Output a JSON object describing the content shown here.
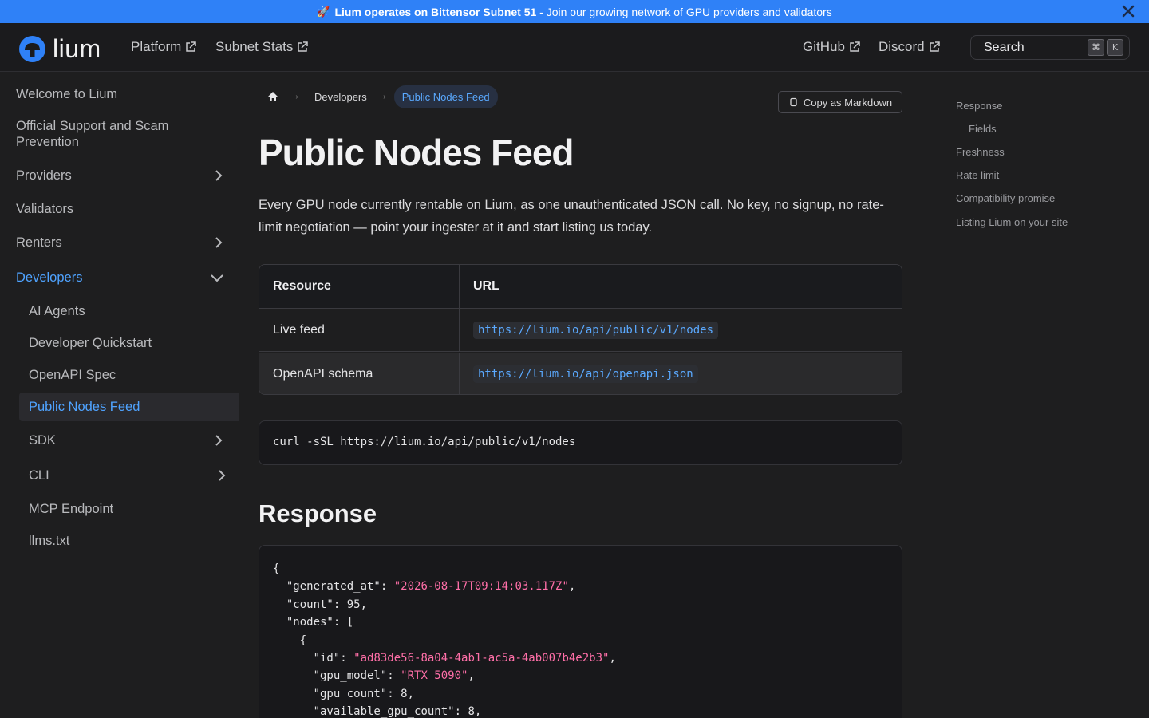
{
  "announcement": {
    "bold": "Lium operates on Bittensor Subnet 51",
    "text": " - Join our growing network of GPU providers and validators"
  },
  "navbar": {
    "logo_text": "lium",
    "links": [
      "Platform",
      "Subnet Stats",
      "GitHub",
      "Discord"
    ],
    "search_placeholder": "Search",
    "shortcut": [
      "⌘",
      "K"
    ]
  },
  "sidebar": {
    "items": [
      "Welcome to Lium",
      "Official Support and Scam Prevention",
      "Providers",
      "Validators",
      "Renters",
      "Developers",
      "AI Agents",
      "Developer Quickstart",
      "OpenAPI Spec",
      "Public Nodes Feed",
      "SDK",
      "CLI",
      "MCP Endpoint",
      "llms.txt"
    ]
  },
  "breadcrumb": {
    "items": [
      "Developers",
      "Public Nodes Feed"
    ]
  },
  "actions": {
    "copy_markdown": "Copy as Markdown"
  },
  "page": {
    "title": "Public Nodes Feed",
    "intro": "Every GPU node currently rentable on Lium, as one unauthenticated JSON call. No key, no signup, no rate-limit negotiation — point your ingester at it and start listing us today."
  },
  "table": {
    "headers": [
      "Resource",
      "URL"
    ],
    "rows": [
      [
        "Live feed",
        "https://lium.io/api/public/v1/nodes"
      ],
      [
        "OpenAPI schema",
        "https://lium.io/api/openapi.json"
      ]
    ]
  },
  "curl_command": "curl -sSL https://lium.io/api/public/v1/nodes",
  "response": {
    "heading": "Response",
    "json": {
      "generated_at_key": "\"generated_at\"",
      "generated_at_val": "\"2026-08-17T09:14:03.117Z\"",
      "count_key": "\"count\"",
      "count_val": "95",
      "nodes_key": "\"nodes\"",
      "id_key": "\"id\"",
      "id_val": "\"ad83de56-8a04-4ab1-ac5a-4ab007b4e2b3\"",
      "gpu_model_key": "\"gpu_model\"",
      "gpu_model_val": "\"RTX 5090\"",
      "gpu_count_key": "\"gpu_count\"",
      "gpu_count_val": "8",
      "available_key": "\"available_gpu_count\"",
      "available_val": "8"
    }
  },
  "toc": {
    "items": [
      "Response",
      "Fields",
      "Freshness",
      "Rate limit",
      "Compatibility promise",
      "Listing Lium on your site"
    ]
  },
  "colors": {
    "accent": "#2f81f7",
    "link": "#4fa3ff",
    "json_string": "#ff6fa8",
    "background": "#1e1e1f"
  }
}
